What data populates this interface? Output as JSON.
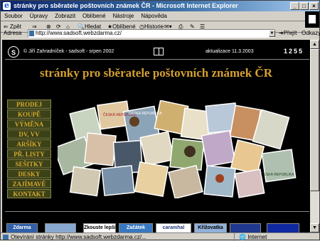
{
  "window": {
    "title": "stránky pro sběratele poštovních známek ČR - Microsoft Internet Explorer"
  },
  "menu": [
    "Soubor",
    "Úpravy",
    "Zobrazit",
    "Oblíbené",
    "Nástroje",
    "Nápověda"
  ],
  "toolbar": {
    "back": "⇐ Zpět",
    "forward": "⇒",
    "search": "Hledat",
    "favorites": "Oblíbené",
    "history": "Historie"
  },
  "address": {
    "label": "Adresa",
    "url": "http://www.sadsoft.webzdarma.cz/",
    "go": "Přejít",
    "links": "Odkazy"
  },
  "page": {
    "logo_letter": "S",
    "copyright": "© Jiří Zahradníček - sadsoft - srpen 2002",
    "updated": "aktualizace 11.3.2003",
    "counter": "1255",
    "heading": "stránky pro sběratele poštovních známek ČR",
    "nav": [
      "PRODEJ",
      "KOUPĚ",
      "VÝMĚNA",
      "DV, VV",
      "ARŠÍKY",
      "PŘ. LISTY",
      "SEŠITKY",
      "DESKY",
      "ZAJÍMAVÉ",
      "KONTAKT"
    ],
    "banners": [
      "Zdarma",
      "",
      "Zkouste lepší",
      "Začátek",
      "caramhal",
      "Křižovatka",
      "",
      ""
    ]
  },
  "stamp_labels": [
    "ČESKÁ REPUBLIKA",
    "ČESKÁ REPUBLIKA",
    "ČESKÁ REPUBLIKA"
  ],
  "status": {
    "text": "Otevírání stránky http://www.sadsoft.webzdarma.cz/...",
    "zone": "Internet"
  },
  "colors": {
    "heading": "#d4a030",
    "nav_bg": "#3c4218",
    "nav_text": "#d4a830",
    "page_bg": "#000000"
  }
}
